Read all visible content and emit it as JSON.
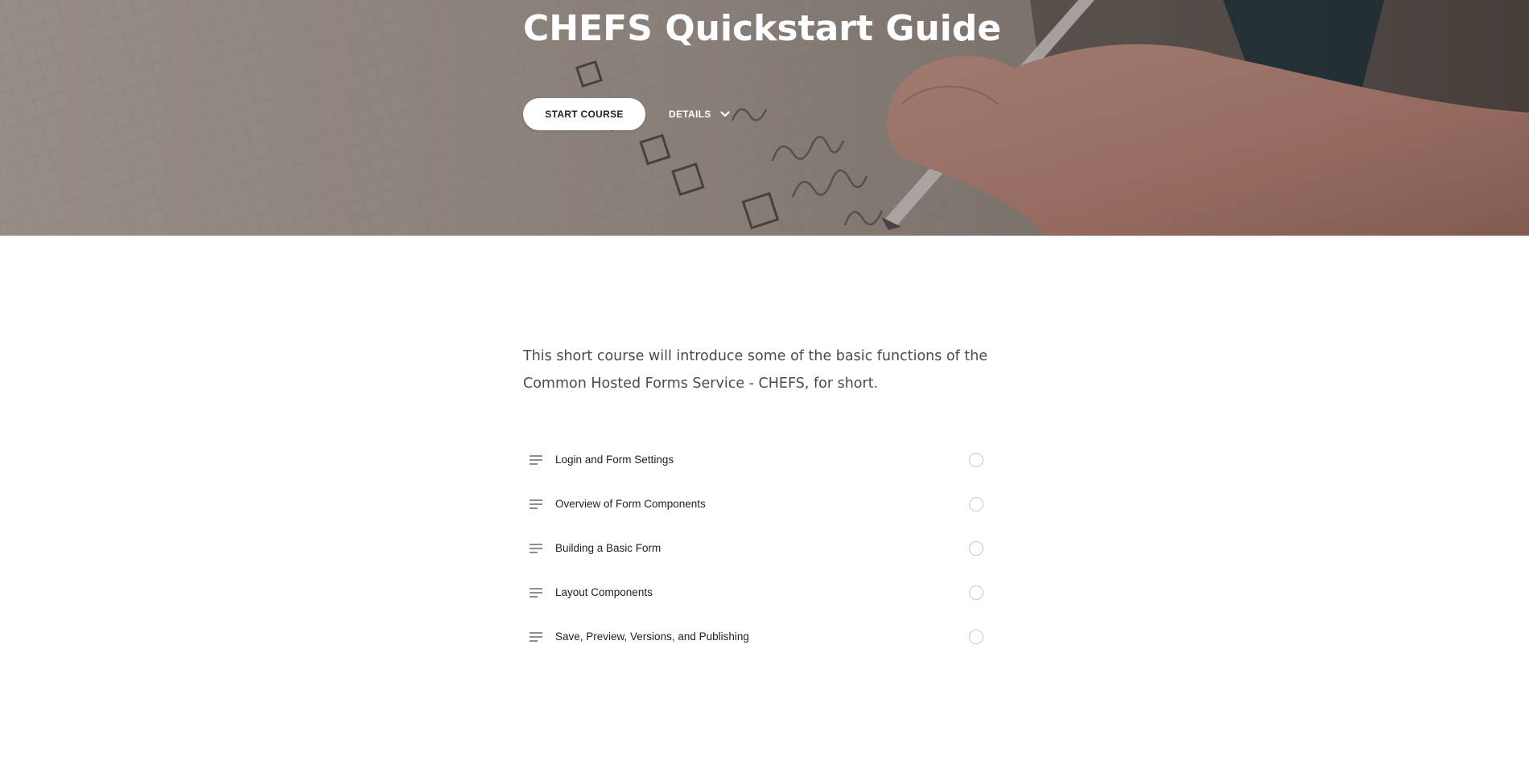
{
  "hero": {
    "title": "CHEFS Quickstart Guide",
    "start_label": "START COURSE",
    "details_label": "DETAILS",
    "details_icon": "chevron-down-icon",
    "background_image": "notebook-checklist-with-hand-holding-pen"
  },
  "description": "This short course will introduce some of the basic functions of the Common Hosted Forms Service - CHEFS, for short.",
  "lessons": [
    {
      "title": "Login and Form Settings",
      "icon": "text-lines-icon",
      "status": "not-started"
    },
    {
      "title": "Overview of Form Components",
      "icon": "text-lines-icon",
      "status": "not-started"
    },
    {
      "title": "Building a Basic Form",
      "icon": "text-lines-icon",
      "status": "not-started"
    },
    {
      "title": "Layout Components",
      "icon": "text-lines-icon",
      "status": "not-started"
    },
    {
      "title": "Save, Preview, Versions, and Publishing",
      "icon": "text-lines-icon",
      "status": "not-started"
    }
  ],
  "colors": {
    "hero_overlay": "#3c322d",
    "title_text": "#ffffff",
    "button_bg": "#ffffff",
    "body_text": "#4a4a4a",
    "status_ring": "#c8c8c8"
  }
}
